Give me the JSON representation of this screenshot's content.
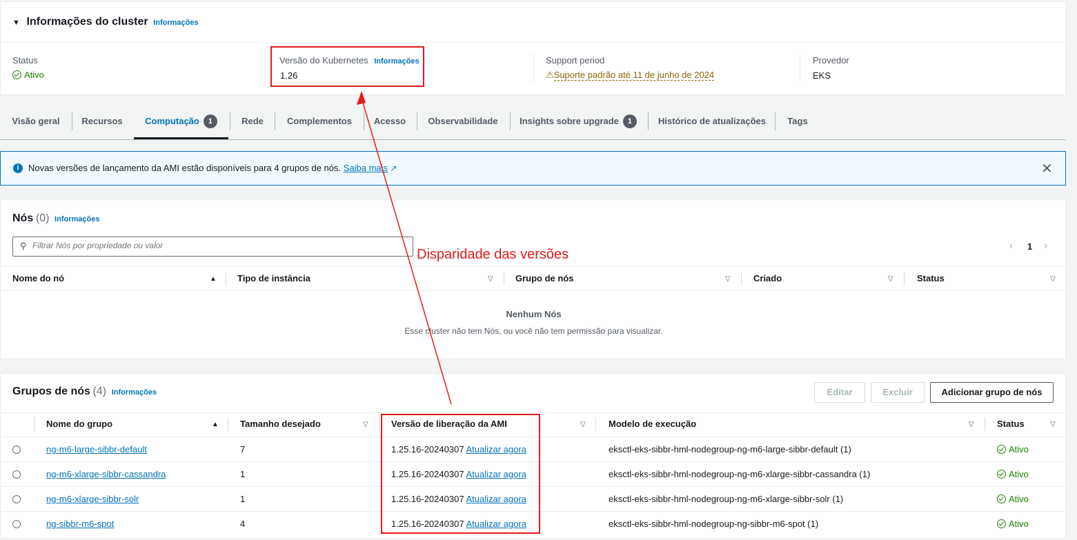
{
  "cluster_info": {
    "title": "Informações do cluster",
    "info_link": "Informações",
    "status_label": "Status",
    "status_value": "Ativo",
    "k8s_label": "Versão do Kubernetes",
    "k8s_info_link": "Informações",
    "k8s_value": "1.26",
    "support_label": "Support period",
    "support_value": "Suporte padrão até 11 de junho de 2024",
    "provider_label": "Provedor",
    "provider_value": "EKS"
  },
  "tabs": [
    {
      "label": "Visão geral"
    },
    {
      "label": "Recursos"
    },
    {
      "label": "Computação",
      "badge": "1"
    },
    {
      "label": "Rede"
    },
    {
      "label": "Complementos"
    },
    {
      "label": "Acesso"
    },
    {
      "label": "Observabilidade"
    },
    {
      "label": "Insights sobre upgrade",
      "badge": "1"
    },
    {
      "label": "Histórico de atualizações"
    },
    {
      "label": "Tags"
    }
  ],
  "alert": {
    "text": "Novas versões de lançamento da AMI estão disponíveis para 4 grupos de nós.",
    "link": "Saiba mais"
  },
  "nodes": {
    "title": "Nós",
    "count": "(0)",
    "info_link": "Informações",
    "filter_placeholder": "Filtrar Nós por propriedade ou valor",
    "page": "1",
    "columns": [
      "Nome do nó",
      "Tipo de instância",
      "Grupo de nós",
      "Criado",
      "Status"
    ],
    "empty_title": "Nenhum Nós",
    "empty_text": "Esse cluster não tem Nós, ou você não tem permissão para visualizar."
  },
  "annotation": {
    "text": "Disparidade das versões",
    "color": "#e31b1b"
  },
  "node_groups": {
    "title": "Grupos de nós",
    "count": "(4)",
    "info_link": "Informações",
    "edit_button": "Editar",
    "delete_button": "Excluir",
    "add_button": "Adicionar grupo de nós",
    "columns": [
      "Nome do grupo",
      "Tamanho desejado",
      "Versão de liberação da AMI",
      "Modelo de execução",
      "Status"
    ],
    "update_link": "Atualizar agora",
    "rows": [
      {
        "name": "ng-m6-large-sibbr-default",
        "size": "7",
        "ami": "1.25.16-20240307",
        "template": "eksctl-eks-sibbr-hml-nodegroup-ng-m6-large-sibbr-default (1)",
        "status": "Ativo"
      },
      {
        "name": "ng-m6-xlarge-sibbr-cassandra",
        "size": "1",
        "ami": "1.25.16-20240307",
        "template": "eksctl-eks-sibbr-hml-nodegroup-ng-m6-xlarge-sibbr-cassandra (1)",
        "status": "Ativo"
      },
      {
        "name": "ng-m6-xlarge-sibbr-solr",
        "size": "1",
        "ami": "1.25.16-20240307",
        "template": "eksctl-eks-sibbr-hml-nodegroup-ng-m6-xlarge-sibbr-solr (1)",
        "status": "Ativo"
      },
      {
        "name": "ng-sibbr-m6-spot",
        "size": "4",
        "ami": "1.25.16-20240307",
        "template": "eksctl-eks-sibbr-hml-nodegroup-ng-sibbr-m6-spot (1)",
        "status": "Ativo"
      }
    ]
  }
}
